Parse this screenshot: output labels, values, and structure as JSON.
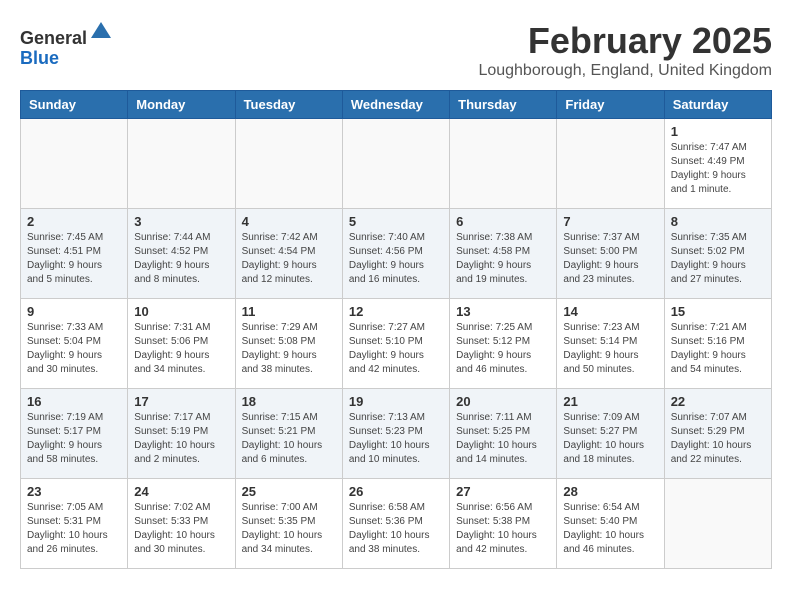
{
  "header": {
    "logo_line1": "General",
    "logo_line2": "Blue",
    "month_title": "February 2025",
    "location": "Loughborough, England, United Kingdom"
  },
  "days_of_week": [
    "Sunday",
    "Monday",
    "Tuesday",
    "Wednesday",
    "Thursday",
    "Friday",
    "Saturday"
  ],
  "weeks": [
    [
      {
        "day": "",
        "info": ""
      },
      {
        "day": "",
        "info": ""
      },
      {
        "day": "",
        "info": ""
      },
      {
        "day": "",
        "info": ""
      },
      {
        "day": "",
        "info": ""
      },
      {
        "day": "",
        "info": ""
      },
      {
        "day": "1",
        "info": "Sunrise: 7:47 AM\nSunset: 4:49 PM\nDaylight: 9 hours and 1 minute."
      }
    ],
    [
      {
        "day": "2",
        "info": "Sunrise: 7:45 AM\nSunset: 4:51 PM\nDaylight: 9 hours and 5 minutes."
      },
      {
        "day": "3",
        "info": "Sunrise: 7:44 AM\nSunset: 4:52 PM\nDaylight: 9 hours and 8 minutes."
      },
      {
        "day": "4",
        "info": "Sunrise: 7:42 AM\nSunset: 4:54 PM\nDaylight: 9 hours and 12 minutes."
      },
      {
        "day": "5",
        "info": "Sunrise: 7:40 AM\nSunset: 4:56 PM\nDaylight: 9 hours and 16 minutes."
      },
      {
        "day": "6",
        "info": "Sunrise: 7:38 AM\nSunset: 4:58 PM\nDaylight: 9 hours and 19 minutes."
      },
      {
        "day": "7",
        "info": "Sunrise: 7:37 AM\nSunset: 5:00 PM\nDaylight: 9 hours and 23 minutes."
      },
      {
        "day": "8",
        "info": "Sunrise: 7:35 AM\nSunset: 5:02 PM\nDaylight: 9 hours and 27 minutes."
      }
    ],
    [
      {
        "day": "9",
        "info": "Sunrise: 7:33 AM\nSunset: 5:04 PM\nDaylight: 9 hours and 30 minutes."
      },
      {
        "day": "10",
        "info": "Sunrise: 7:31 AM\nSunset: 5:06 PM\nDaylight: 9 hours and 34 minutes."
      },
      {
        "day": "11",
        "info": "Sunrise: 7:29 AM\nSunset: 5:08 PM\nDaylight: 9 hours and 38 minutes."
      },
      {
        "day": "12",
        "info": "Sunrise: 7:27 AM\nSunset: 5:10 PM\nDaylight: 9 hours and 42 minutes."
      },
      {
        "day": "13",
        "info": "Sunrise: 7:25 AM\nSunset: 5:12 PM\nDaylight: 9 hours and 46 minutes."
      },
      {
        "day": "14",
        "info": "Sunrise: 7:23 AM\nSunset: 5:14 PM\nDaylight: 9 hours and 50 minutes."
      },
      {
        "day": "15",
        "info": "Sunrise: 7:21 AM\nSunset: 5:16 PM\nDaylight: 9 hours and 54 minutes."
      }
    ],
    [
      {
        "day": "16",
        "info": "Sunrise: 7:19 AM\nSunset: 5:17 PM\nDaylight: 9 hours and 58 minutes."
      },
      {
        "day": "17",
        "info": "Sunrise: 7:17 AM\nSunset: 5:19 PM\nDaylight: 10 hours and 2 minutes."
      },
      {
        "day": "18",
        "info": "Sunrise: 7:15 AM\nSunset: 5:21 PM\nDaylight: 10 hours and 6 minutes."
      },
      {
        "day": "19",
        "info": "Sunrise: 7:13 AM\nSunset: 5:23 PM\nDaylight: 10 hours and 10 minutes."
      },
      {
        "day": "20",
        "info": "Sunrise: 7:11 AM\nSunset: 5:25 PM\nDaylight: 10 hours and 14 minutes."
      },
      {
        "day": "21",
        "info": "Sunrise: 7:09 AM\nSunset: 5:27 PM\nDaylight: 10 hours and 18 minutes."
      },
      {
        "day": "22",
        "info": "Sunrise: 7:07 AM\nSunset: 5:29 PM\nDaylight: 10 hours and 22 minutes."
      }
    ],
    [
      {
        "day": "23",
        "info": "Sunrise: 7:05 AM\nSunset: 5:31 PM\nDaylight: 10 hours and 26 minutes."
      },
      {
        "day": "24",
        "info": "Sunrise: 7:02 AM\nSunset: 5:33 PM\nDaylight: 10 hours and 30 minutes."
      },
      {
        "day": "25",
        "info": "Sunrise: 7:00 AM\nSunset: 5:35 PM\nDaylight: 10 hours and 34 minutes."
      },
      {
        "day": "26",
        "info": "Sunrise: 6:58 AM\nSunset: 5:36 PM\nDaylight: 10 hours and 38 minutes."
      },
      {
        "day": "27",
        "info": "Sunrise: 6:56 AM\nSunset: 5:38 PM\nDaylight: 10 hours and 42 minutes."
      },
      {
        "day": "28",
        "info": "Sunrise: 6:54 AM\nSunset: 5:40 PM\nDaylight: 10 hours and 46 minutes."
      },
      {
        "day": "",
        "info": ""
      }
    ]
  ]
}
